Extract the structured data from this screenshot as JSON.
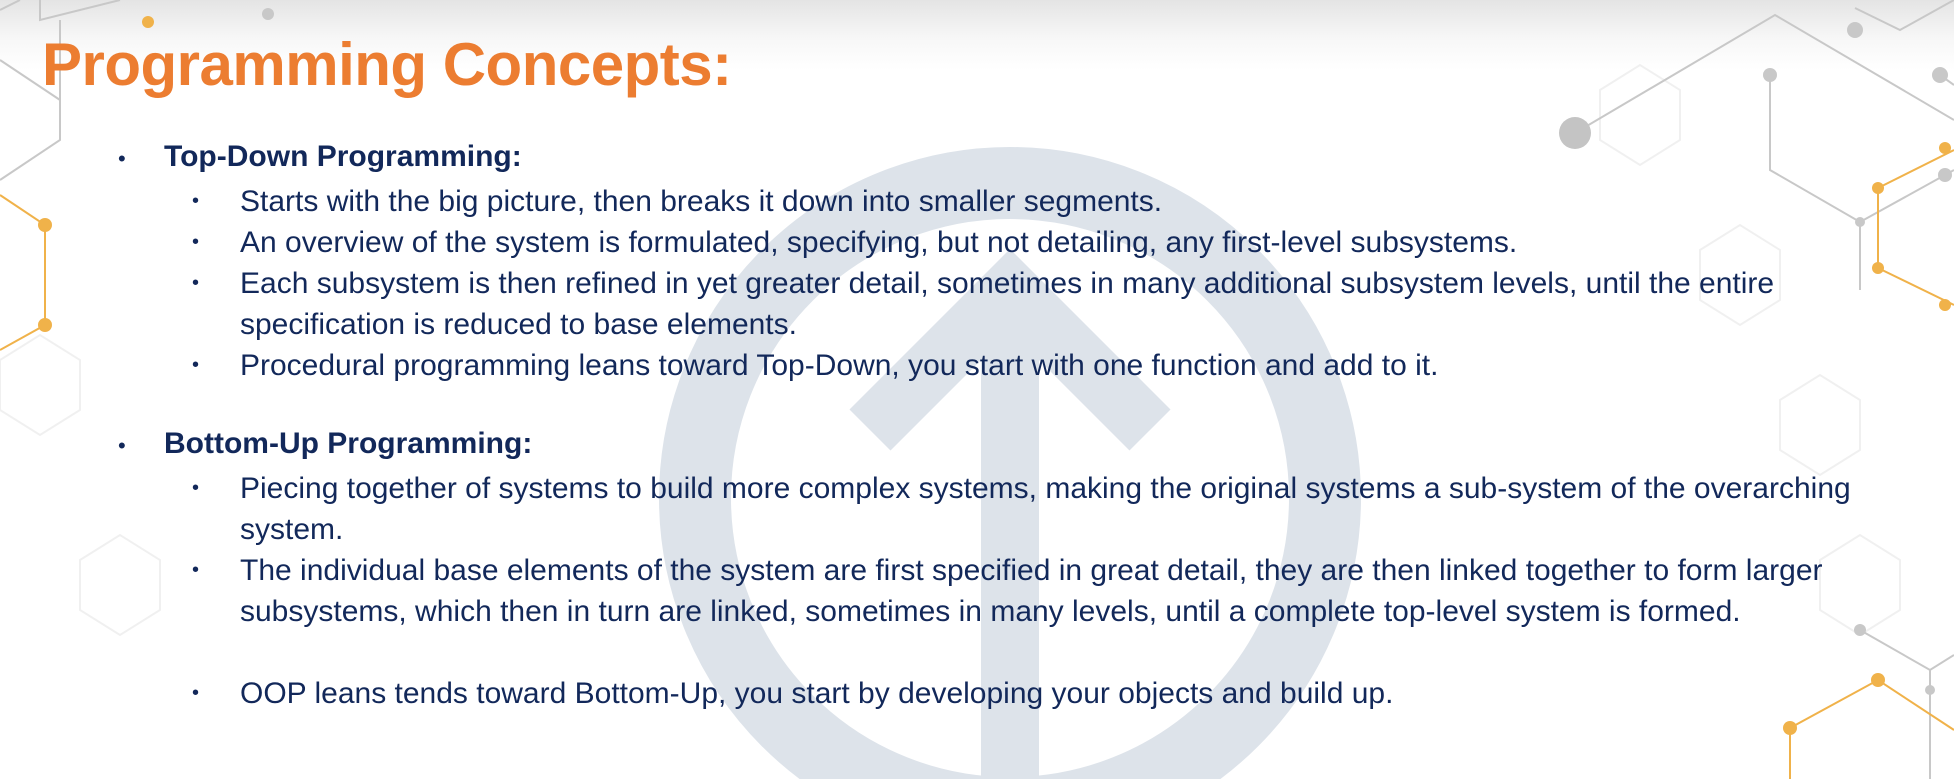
{
  "title": "Programming Concepts:",
  "sections": [
    {
      "heading": "Top-Down Programming:",
      "items": [
        "Starts with the big picture, then breaks it down into smaller segments.",
        "An overview of the system is formulated, specifying, but not detailing, any first-level subsystems.",
        "Each subsystem is then refined in yet greater detail, sometimes in many additional subsystem levels, until the entire specification is reduced to base elements.",
        "Procedural programming leans toward Top-Down, you start with one function and add to it."
      ]
    },
    {
      "heading": "Bottom-Up Programming:",
      "items": [
        "Piecing together of systems to build more complex systems, making the original systems a sub-system of the overarching system.",
        "The individual base elements of the system are first specified in great detail, they are then linked together to form larger subsystems, which then in turn are linked, sometimes in many levels, until a complete top-level system is formed.",
        "OOP leans tends toward Bottom-Up, you start by developing your objects and build up."
      ]
    }
  ],
  "colors": {
    "title": "#ec7d31",
    "text": "#12285a",
    "watermark": "#dde3ea",
    "network_orange": "#f0b24a",
    "network_gray": "#b8b8b8"
  },
  "icons": [
    "up-arrow-watermark-icon",
    "network-decoration-icon"
  ]
}
